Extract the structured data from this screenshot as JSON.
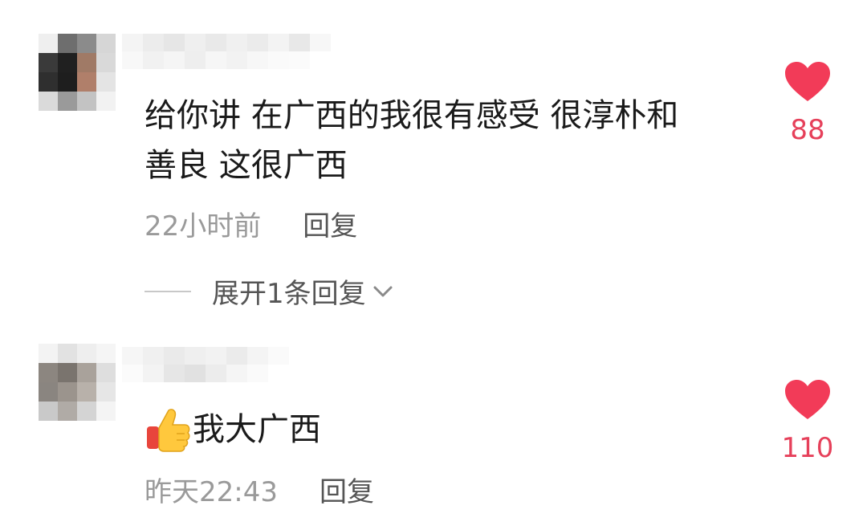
{
  "comments": [
    {
      "text_line1": "给你讲 在广西的我很有感受 很淳朴和",
      "text_line2": "善良 这很广西",
      "time": "22小时前",
      "reply_label": "回复",
      "expand_label": "展开1条回复",
      "likes": "88"
    },
    {
      "text": "我大广西",
      "time": "昨天22:43",
      "reply_label": "回复",
      "likes": "110"
    }
  ],
  "colors": {
    "like_red": "#f23b58",
    "muted_text": "#9a9a9a",
    "action_text": "#555555"
  },
  "icons": {
    "like": "heart-icon",
    "expand": "chevron-down-icon",
    "emoji": "thumbs-up-icon"
  }
}
